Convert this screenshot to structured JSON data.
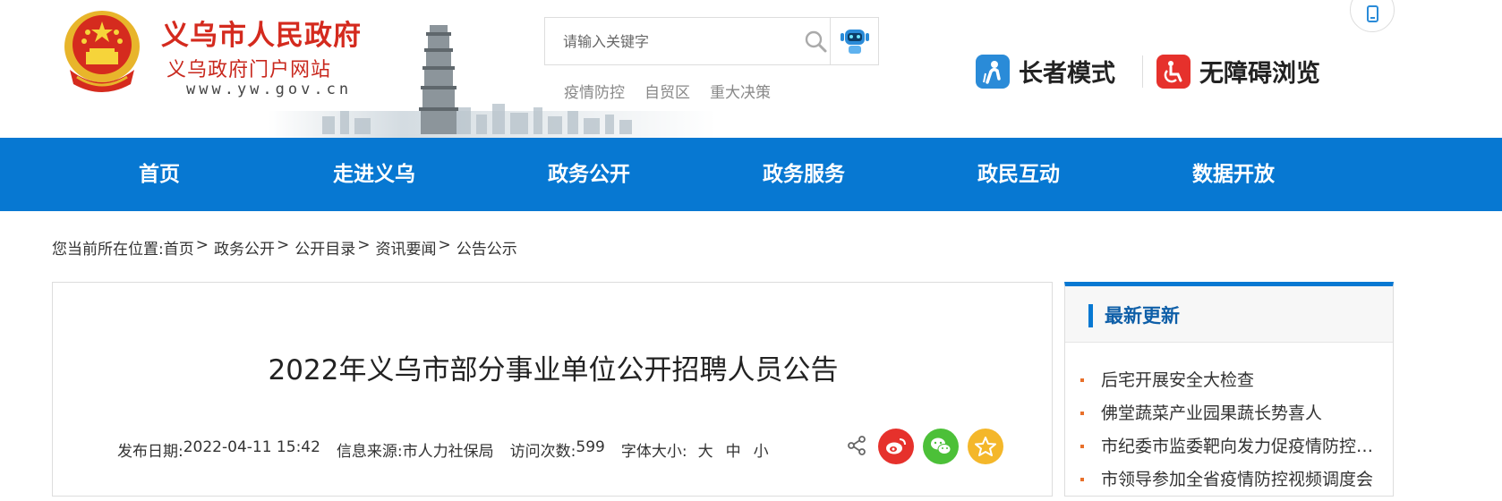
{
  "header": {
    "site_name": "义乌市人民政府",
    "site_subtitle": "义乌政府门户网站",
    "site_url": "www.yw.gov.cn",
    "search_placeholder": "请输入关键字",
    "hot_links": [
      "疫情防控",
      "自贸区",
      "重大决策"
    ],
    "elder_mode": "长者模式",
    "accessible_mode": "无障碍浏览",
    "icons": [
      "national-emblem",
      "search-icon",
      "robot-icon",
      "phone-icon",
      "elder-icon",
      "wheelchair-icon"
    ]
  },
  "nav": {
    "items": [
      "首页",
      "走进义乌",
      "政务公开",
      "政务服务",
      "政民互动",
      "数据开放"
    ],
    "color": "#0778d2"
  },
  "breadcrumb": {
    "prefix": "您当前所在位置:",
    "items": [
      "首页",
      "政务公开",
      "公开目录",
      "资讯要闻",
      "公告公示"
    ],
    "separator": ">"
  },
  "article": {
    "title": "2022年义乌市部分事业单位公开招聘人员公告",
    "publish_label": "发布日期:",
    "publish_date": "2022-04-11 15:42",
    "source_label": "信息来源:",
    "source": "市人力社保局",
    "visits_label": "访问次数:",
    "visits": "599",
    "font_size_label": "字体大小:",
    "font_sizes": [
      "大",
      "中",
      "小"
    ],
    "share_icons": [
      "share-icon",
      "weibo-icon",
      "wechat-icon",
      "favorite-icon"
    ]
  },
  "sidebar": {
    "title": "最新更新",
    "items": [
      "后宅开展安全大检查",
      "佛堂蔬菜产业园果蔬长势喜人",
      "市纪委市监委靶向发力促疫情防控…",
      "市领导参加全省疫情防控视频调度会"
    ]
  }
}
